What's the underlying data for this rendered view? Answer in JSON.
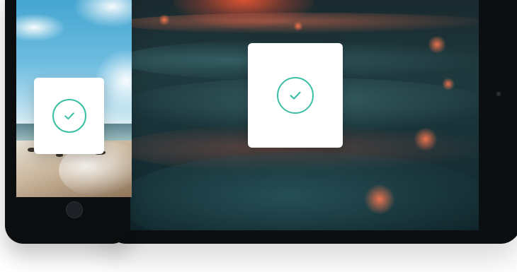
{
  "scene": {
    "tablet": {
      "status": "success",
      "status_icon": "checkmark-circle-icon"
    },
    "phone": {
      "status": "success",
      "status_icon": "checkmark-circle-icon"
    }
  },
  "colors": {
    "accent": "#3cc0a5",
    "card_background": "#ffffff",
    "device_frame": "#0b0f12"
  }
}
